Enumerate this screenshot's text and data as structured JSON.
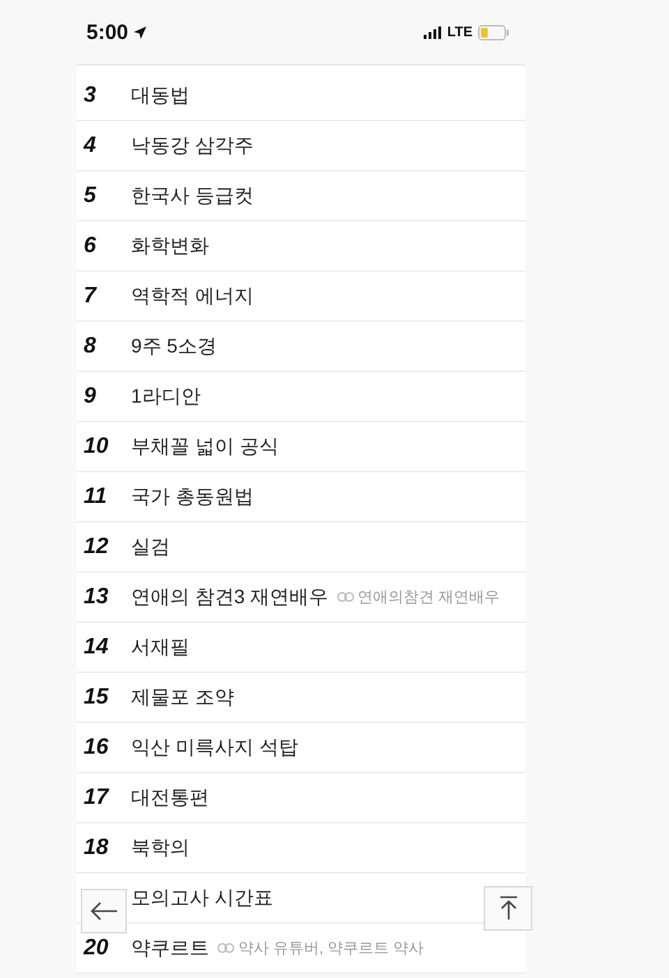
{
  "status_bar": {
    "time": "5:00",
    "network": "LTE"
  },
  "rows": [
    {
      "rank": "3",
      "title": "대동법"
    },
    {
      "rank": "4",
      "title": "낙동강 삼각주"
    },
    {
      "rank": "5",
      "title": "한국사 등급컷"
    },
    {
      "rank": "6",
      "title": "화학변화"
    },
    {
      "rank": "7",
      "title": "역학적 에너지"
    },
    {
      "rank": "8",
      "title": "9주 5소경"
    },
    {
      "rank": "9",
      "title": "1라디안"
    },
    {
      "rank": "10",
      "title": "부채꼴 넓이 공식"
    },
    {
      "rank": "11",
      "title": "국가 총동원법"
    },
    {
      "rank": "12",
      "title": "실검"
    },
    {
      "rank": "13",
      "title": "연애의 참견3 재연배우",
      "related": "연애의참견 재연배우"
    },
    {
      "rank": "14",
      "title": "서재필"
    },
    {
      "rank": "15",
      "title": "제물포 조약"
    },
    {
      "rank": "16",
      "title": "익산 미륵사지 석탑"
    },
    {
      "rank": "17",
      "title": "대전통편"
    },
    {
      "rank": "18",
      "title": "북학의"
    },
    {
      "title": "모의고사 시간표"
    },
    {
      "rank": "20",
      "title": "약쿠르트",
      "related": "약사 유튜버, 약쿠르트 약사"
    }
  ]
}
